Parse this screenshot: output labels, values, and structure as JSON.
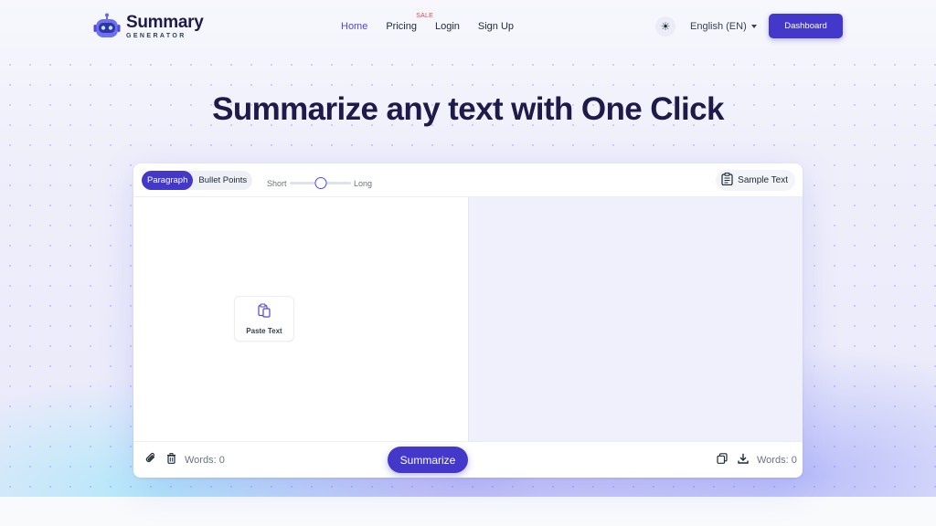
{
  "brand": {
    "title": "Summary",
    "subtitle": "GENERATOR"
  },
  "nav": {
    "items": [
      {
        "label": "Home",
        "active": true
      },
      {
        "label": "Pricing",
        "badge": "SALE"
      },
      {
        "label": "Login"
      },
      {
        "label": "Sign Up"
      }
    ]
  },
  "header": {
    "theme_icon": "sun-icon",
    "language": "English (EN)",
    "dashboard_label": "Dashboard"
  },
  "hero": {
    "headline": "Summarize any text with One Click"
  },
  "editor": {
    "modes": [
      "Paragraph",
      "Bullet Points"
    ],
    "active_mode": "Paragraph",
    "length": {
      "short_label": "Short",
      "long_label": "Long",
      "value": 0.5
    },
    "sample_text_label": "Sample Text",
    "paste_label": "Paste Text",
    "input_words_label": "Words: 0",
    "output_words_label": "Words: 0",
    "summarize_label": "Summarize"
  },
  "colors": {
    "accent": "#4338ca",
    "link_active": "#4f46e5",
    "sale": "#ef4444",
    "output_bg": "#eff0fb"
  }
}
